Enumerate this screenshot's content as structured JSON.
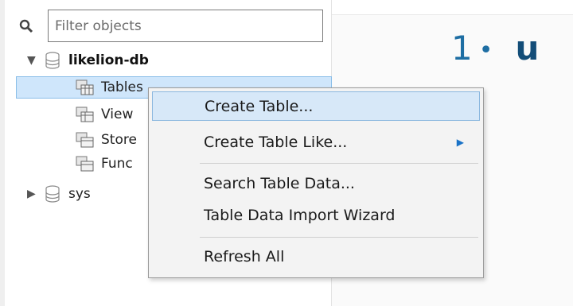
{
  "navigator": {
    "filter_placeholder": "Filter objects",
    "schemas": [
      {
        "name": "likelion-db",
        "expanded": true,
        "children": [
          "Tables",
          "Views",
          "Stored Procedures",
          "Functions"
        ]
      },
      {
        "name": "sys",
        "expanded": false
      }
    ],
    "visible_child_labels": [
      "Tables",
      "View",
      "Store",
      "Func"
    ]
  },
  "content": {
    "heading_number": "1",
    "heading_dot": "•",
    "heading_letter": "u"
  },
  "context_menu": {
    "items": [
      {
        "label": "Create Table...",
        "highlighted": true
      },
      {
        "label": "Create Table Like...",
        "has_submenu": true
      },
      {
        "label": "Search Table Data..."
      },
      {
        "label": "Table Data Import Wizard"
      },
      {
        "label": "Refresh All"
      }
    ]
  },
  "colors": {
    "selection_bg": "#cfe6fb",
    "menu_bg": "#f3f3f3",
    "heading": "#1e6ea3"
  },
  "icons": {
    "search": "magnifier-icon",
    "database": "database-cylinder-icon",
    "folder": "table-group-icon",
    "expand": "triangle-down-icon",
    "collapse": "triangle-right-icon",
    "submenu": "triangle-right-icon"
  }
}
